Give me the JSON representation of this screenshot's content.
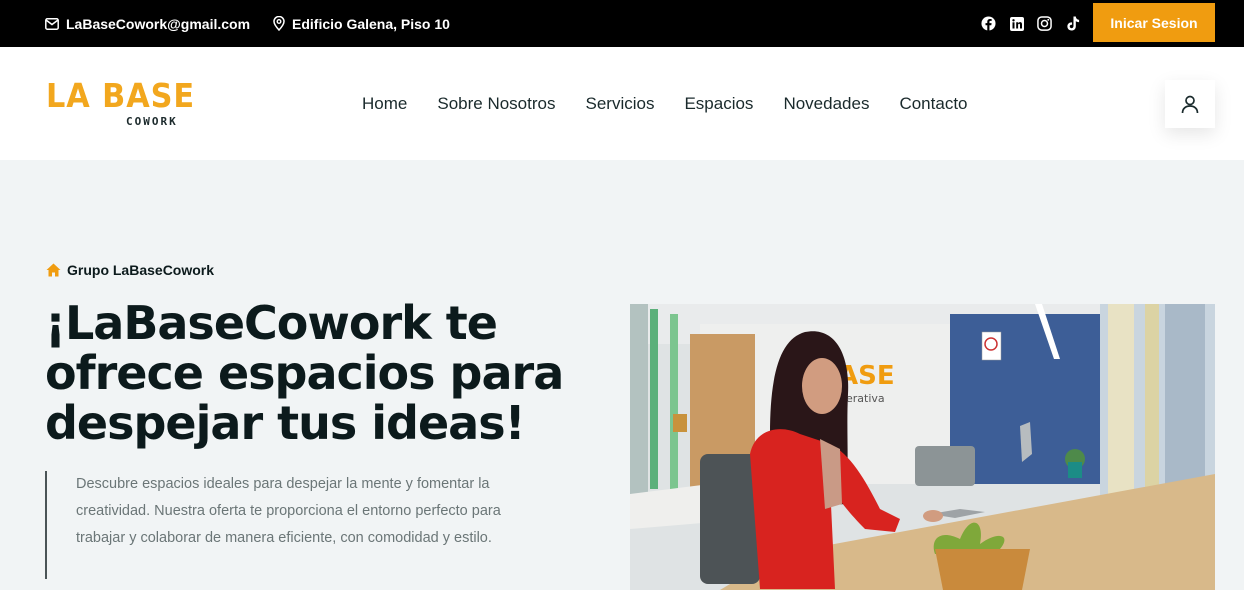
{
  "topbar": {
    "email": "LaBaseCowork@gmail.com",
    "address": "Edificio Galena, Piso 10",
    "socials": [
      "facebook-icon",
      "linkedin-icon",
      "instagram-icon",
      "tiktok-icon"
    ],
    "login_label": "Inicar Sesion"
  },
  "header": {
    "logo_main": "LA BASE",
    "logo_sub": "COWORK",
    "nav": [
      "Home",
      "Sobre Nosotros",
      "Servicios",
      "Espacios",
      "Novedades",
      "Contacto"
    ]
  },
  "hero": {
    "breadcrumb": "Grupo LaBaseCowork",
    "title_line1": "¡LaBaseCowork te",
    "title_line2": "ofrece espacios para",
    "title_line3": "despejar tus ideas!",
    "description": "Descubre espacios ideales para despejar la mente y fomentar la creatividad. Nuestra oferta te proporciona el entorno perfecto para trabajar y colaborar de manera eficiente, con comodidad y estilo.",
    "image_wall_text": "ASE",
    "image_wall_subtext": "erativa"
  },
  "colors": {
    "accent": "#f09c10",
    "topbar_bg": "#000000",
    "hero_bg": "#f1f4f5"
  }
}
